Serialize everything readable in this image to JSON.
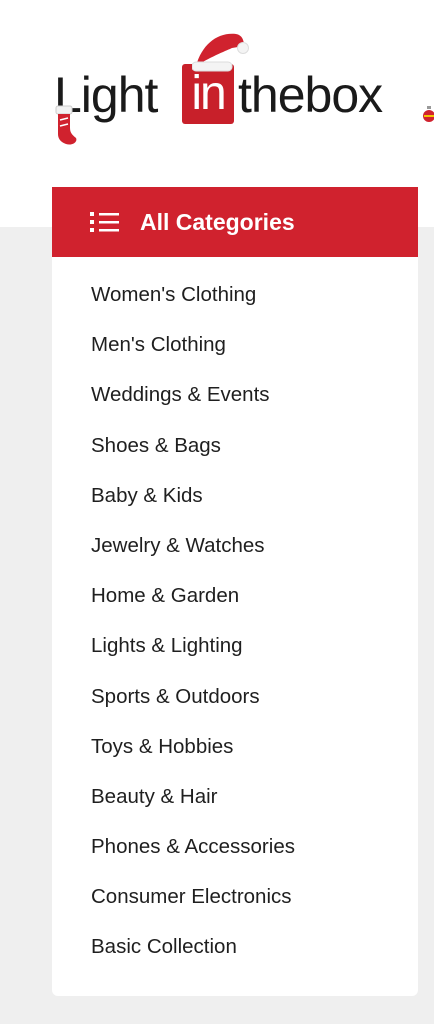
{
  "logo": {
    "text_left": "Light",
    "text_box": "in",
    "text_right": "thebox",
    "brand_color": "#c8202a"
  },
  "categories": {
    "header_label": "All Categories",
    "header_icon": "list-icon",
    "header_color": "#d0222e",
    "items": [
      {
        "label": "Women's Clothing"
      },
      {
        "label": "Men's Clothing"
      },
      {
        "label": "Weddings & Events"
      },
      {
        "label": "Shoes & Bags"
      },
      {
        "label": "Baby & Kids"
      },
      {
        "label": "Jewelry & Watches"
      },
      {
        "label": "Home & Garden"
      },
      {
        "label": "Lights & Lighting"
      },
      {
        "label": "Sports & Outdoors"
      },
      {
        "label": "Toys & Hobbies"
      },
      {
        "label": "Beauty & Hair"
      },
      {
        "label": "Phones & Accessories"
      },
      {
        "label": "Consumer Electronics"
      },
      {
        "label": "Basic Collection"
      }
    ]
  }
}
